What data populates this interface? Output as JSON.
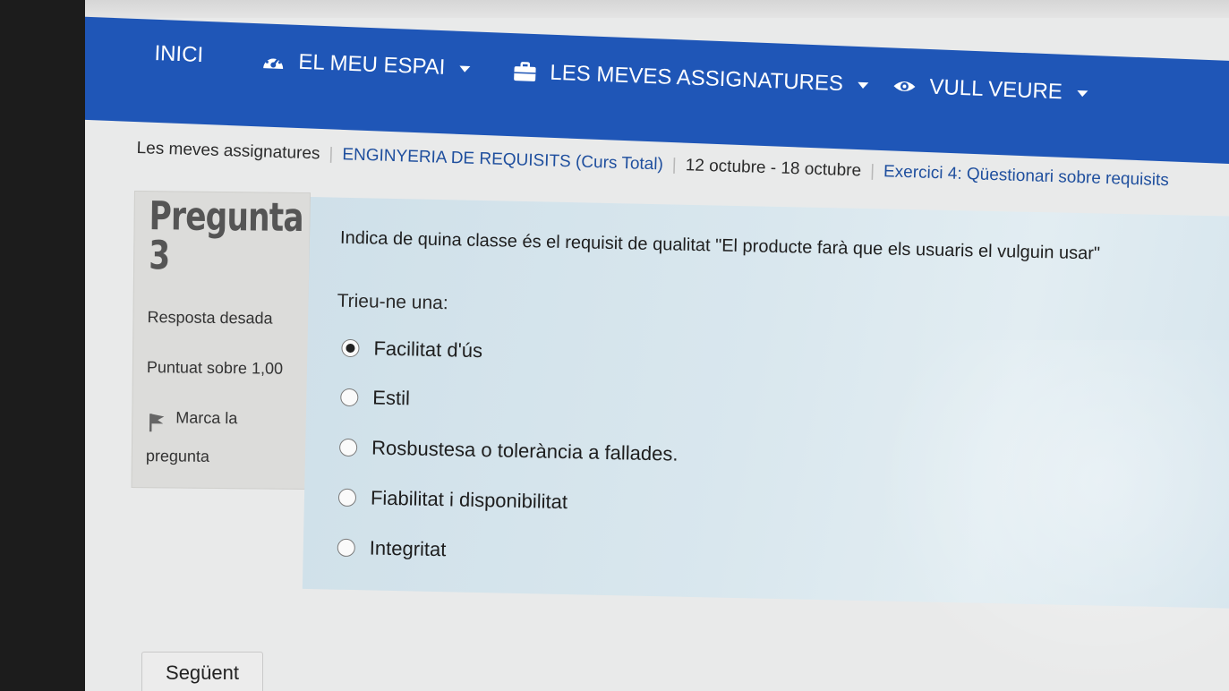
{
  "nav": {
    "home": "INICI",
    "my_space": "EL MEU ESPAI",
    "my_subjects": "LES MEVES ASSIGNATURES",
    "want_to_see": "VULL VEURE"
  },
  "breadcrumb": {
    "items": [
      "Les meves assignatures",
      "ENGINYERIA DE REQUISITS (Curs Total)",
      "12 octubre - 18 octubre",
      "Exercici 4: Qüestionari sobre requisits"
    ]
  },
  "question_info": {
    "label": "Pregunta",
    "number": "3",
    "status": "Resposta desada",
    "grade": "Puntuat sobre 1,00",
    "flag_line1": "Marca la",
    "flag_line2": "pregunta"
  },
  "question": {
    "text": "Indica de quina classe és el requisit de qualitat \"El producte farà que els usuaris el vulguin usar\"",
    "prompt": "Trieu-ne una:",
    "options": [
      {
        "label": "Facilitat d'ús",
        "selected": true
      },
      {
        "label": "Estil",
        "selected": false
      },
      {
        "label": "Rosbustesa o tolerància a fallades.",
        "selected": false
      },
      {
        "label": "Fiabilitat i disponibilitat",
        "selected": false
      },
      {
        "label": "Integritat",
        "selected": false
      }
    ]
  },
  "buttons": {
    "next": "Següent"
  },
  "icons": {
    "my_space": "dashboard-icon",
    "my_subjects": "briefcase-icon",
    "want_to_see": "eye-icon",
    "flag": "flag-icon"
  },
  "colors": {
    "navbar": "#1f56b7",
    "link": "#1f4f9e",
    "content_bg": "#d9e7ee"
  }
}
